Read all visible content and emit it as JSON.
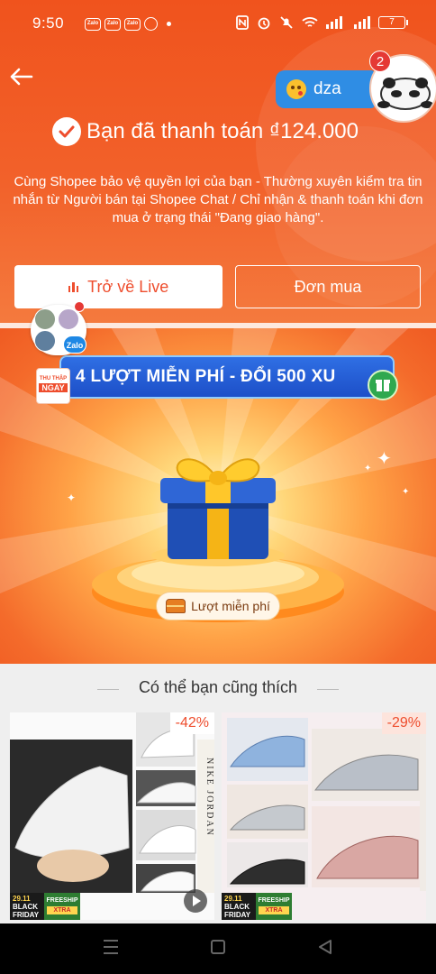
{
  "status_bar": {
    "time": "9:50",
    "apps": [
      "Zalo",
      "Zalo",
      "Zalo"
    ],
    "battery": "7"
  },
  "header": {
    "chat_bubble_text": "dza",
    "chat_badge_count": "2",
    "payment_text": "Bạn đã thanh toán ₫124.000",
    "note": "Cùng Shopee bảo vệ quyền lợi của bạn - Thường xuyên kiểm tra tin nhắn từ Người bán tại Shopee Chat / Chỉ nhận & thanh toán khi đơn mua ở trạng thái \"Đang giao hàng\".",
    "back_live_label": "Trở về Live",
    "orders_label": "Đơn mua"
  },
  "gift": {
    "banner": "4 LƯỢT MIỄN PHÍ - ĐỔI 500 XU",
    "collect_top": "THU THẬP",
    "collect_bottom": "NGAY",
    "zalo_tag": "Zalo",
    "free_turn_label": "Lượt miễn phí"
  },
  "recommendations": {
    "title": "Có thể bạn cũng thích",
    "products": [
      {
        "discount": "-42%",
        "brand_text": "NIKE JORDAN",
        "promo_date": "29.11",
        "promo_event": "BLACK FRIDAY",
        "promo_ship": "FREESHIP",
        "promo_xtra": "XTRA"
      },
      {
        "discount": "-29%",
        "promo_date": "29.11",
        "promo_event": "BLACK FRIDAY",
        "promo_ship": "FREESHIP",
        "promo_xtra": "XTRA"
      }
    ]
  },
  "colors": {
    "shopee_orange": "#ee4d2d",
    "banner_blue": "#1d4fc8",
    "gift_blue": "#1f4fb5",
    "gift_gold": "#f5b416"
  }
}
